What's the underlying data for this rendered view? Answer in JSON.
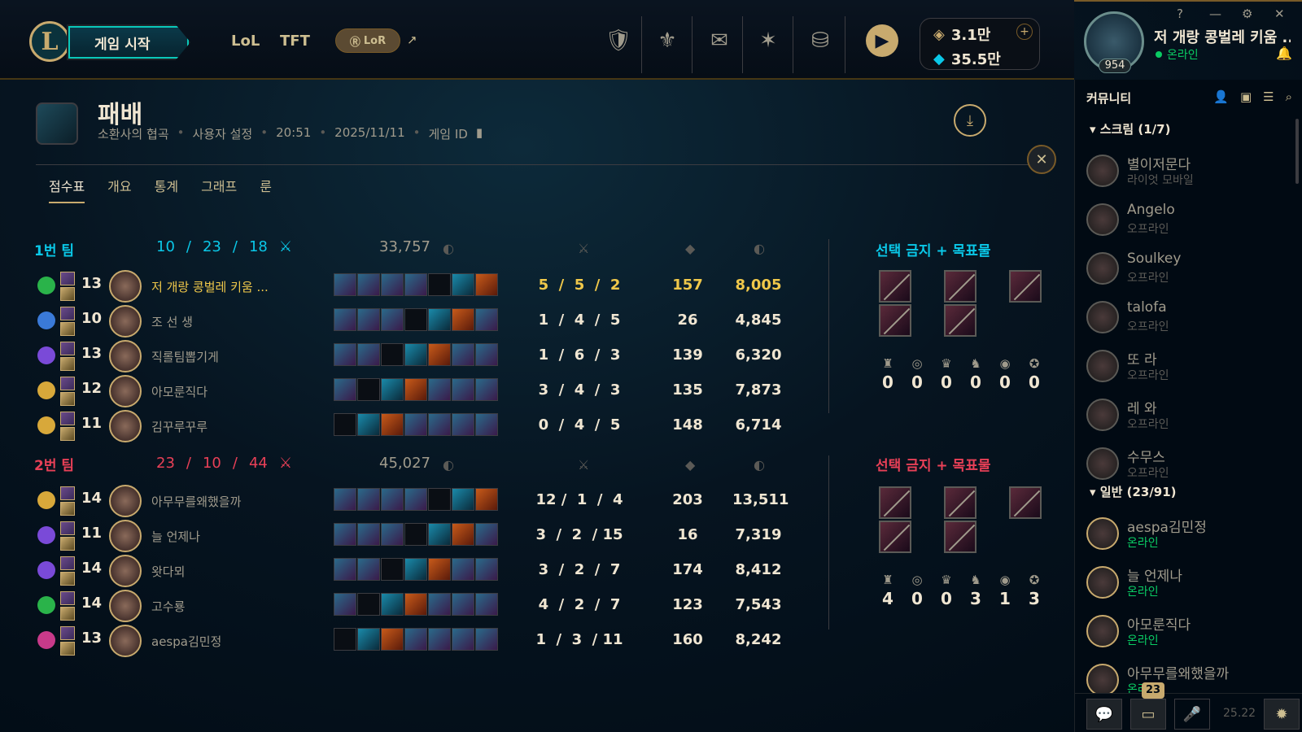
{
  "header": {
    "play_label": "게임 시작",
    "tabs": [
      "LoL",
      "TFT"
    ],
    "lor_label": "LoR",
    "currency": {
      "rp": "3.1만",
      "be": "35.5만"
    },
    "window_controls": [
      "?",
      "—",
      "⚙",
      "✕"
    ]
  },
  "profile": {
    "name": "저 개랑 콩벌레 키움 ...",
    "status": "온라인",
    "level": "954"
  },
  "match": {
    "result": "패배",
    "meta": [
      "소환사의 협곡",
      "사용자 설정",
      "20:51",
      "2025/11/11",
      "게임 ID"
    ],
    "tabs": [
      "점수표",
      "개요",
      "통계",
      "그래프",
      "룬"
    ]
  },
  "team1": {
    "name": "1번 팀",
    "kda": [
      "10",
      "/",
      "23",
      "/",
      "18"
    ],
    "gold": "33,757",
    "ban_label": "선택 금지 + 목표물",
    "objectives": [
      "0",
      "0",
      "0",
      "0",
      "0",
      "0"
    ],
    "players": [
      {
        "level": "13",
        "name": "저 개랑 콩벌레 키움 ...",
        "kda": "5  /  5  /  2",
        "cs": "157",
        "gold": "8,005",
        "me": true,
        "rune": "#2ab34a"
      },
      {
        "level": "10",
        "name": "조 선 생",
        "kda": "1  /  4  /  5",
        "cs": "26",
        "gold": "4,845",
        "rune": "#3a7ad8"
      },
      {
        "level": "13",
        "name": "직롤팀뽑기게",
        "kda": "1  /  6  /  3",
        "cs": "139",
        "gold": "6,320",
        "rune": "#7a4ad8"
      },
      {
        "level": "12",
        "name": "아모룬직다",
        "kda": "3  /  4  /  3",
        "cs": "135",
        "gold": "7,873",
        "rune": "#d8a83a"
      },
      {
        "level": "11",
        "name": "김꾸루꾸루",
        "kda": "0  /  4  /  5",
        "cs": "148",
        "gold": "6,714",
        "rune": "#d8a83a"
      }
    ]
  },
  "team2": {
    "name": "2번 팀",
    "kda": [
      "23",
      "/",
      "10",
      "/",
      "44"
    ],
    "gold": "45,027",
    "ban_label": "선택 금지 + 목표물",
    "objectives": [
      "4",
      "0",
      "0",
      "3",
      "1",
      "3"
    ],
    "players": [
      {
        "level": "14",
        "name": "아무무를왜했을까",
        "kda": "12 /  1  /  4",
        "cs": "203",
        "gold": "13,511",
        "rune": "#d8a83a"
      },
      {
        "level": "11",
        "name": "늘 언제나",
        "kda": "3  /  2  / 15",
        "cs": "16",
        "gold": "7,319",
        "rune": "#7a4ad8"
      },
      {
        "level": "14",
        "name": "왓다뫼",
        "kda": "3  /  2  /  7",
        "cs": "174",
        "gold": "8,412",
        "rune": "#7a4ad8"
      },
      {
        "level": "14",
        "name": "고수룡",
        "kda": "4  /  2  /  7",
        "cs": "123",
        "gold": "7,543",
        "rune": "#2ab34a"
      },
      {
        "level": "13",
        "name": "aespa김민정",
        "kda": "1  /  3  / 11",
        "cs": "160",
        "gold": "8,242",
        "rune": "#c83a8a"
      }
    ]
  },
  "social": {
    "title": "커뮤니티",
    "groups": [
      {
        "label": "스크림 (1/7)"
      },
      {
        "label": "일반 (23/91)"
      }
    ],
    "friends": [
      {
        "name": "별이저문다",
        "status": "라이엇 모바일",
        "kind": "mob"
      },
      {
        "name": "Angelo",
        "status": "오프라인",
        "kind": "off"
      },
      {
        "name": "Soulkey",
        "status": "오프라인",
        "kind": "off"
      },
      {
        "name": "talofa",
        "status": "오프라인",
        "kind": "off"
      },
      {
        "name": "또 라",
        "status": "오프라인",
        "kind": "off"
      },
      {
        "name": "레 와",
        "status": "오프라인",
        "kind": "off"
      },
      {
        "name": "수무스",
        "status": "오프라인",
        "kind": "off"
      },
      {
        "name": "aespa김민정",
        "status": "온라인",
        "kind": "on"
      },
      {
        "name": "늘 언제나",
        "status": "온라인",
        "kind": "on"
      },
      {
        "name": "아모룬직다",
        "status": "온라인",
        "kind": "on"
      },
      {
        "name": "아무무를왜했을까",
        "status": "온라인",
        "kind": "on"
      }
    ],
    "badge_count": "23",
    "version": "25.22"
  },
  "icons": {
    "header": [
      "trophy-icon",
      "champion-icon",
      "loot-icon",
      "tft-icon",
      "coins-icon"
    ],
    "objectives": [
      "tower-icon",
      "inhibitor-icon",
      "baron-icon",
      "dragon-icon",
      "herald-icon",
      "atakhan-icon"
    ]
  }
}
